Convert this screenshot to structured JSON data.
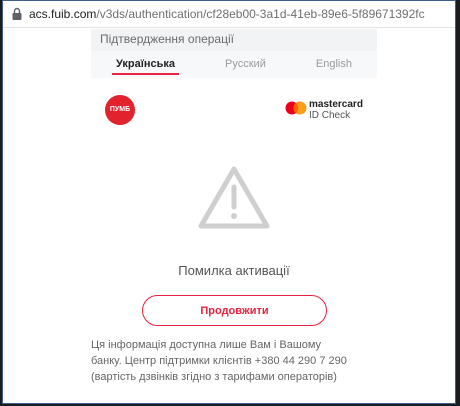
{
  "browser": {
    "url_host": "acs.fuib.com",
    "url_path": "/v3ds/authentication/cf28eb00-3a1d-41eb-89e6-5f89671392fc"
  },
  "page": {
    "title": "Підтвердження операції",
    "languages": [
      {
        "label": "Українська",
        "active": true
      },
      {
        "label": "Русский",
        "active": false
      },
      {
        "label": "English",
        "active": false
      }
    ],
    "bank_logo_text": "ПУМБ",
    "mastercard": {
      "word": "mastercard",
      "sub": "ID Check"
    },
    "error_message": "Помилка активації",
    "continue_label": "Продовжити",
    "info_lines": [
      "Ця інформація доступна лише Вам і Вашому",
      "банку. Центр підтримки клієнтів +380 44 290 7 290",
      "(вартість дзвінків згідно з тарифами операторів)"
    ]
  },
  "colors": {
    "accent": "#e8233f",
    "pumb_red": "#e2232d",
    "mc_red": "#eb001b",
    "mc_yellow": "#f79e1b",
    "mc_overlap": "#ff5f00",
    "warn_gray": "#cfcfcf"
  },
  "icons": [
    "lock-icon",
    "warning-triangle-icon",
    "pumb-logo",
    "mastercard-logo"
  ]
}
